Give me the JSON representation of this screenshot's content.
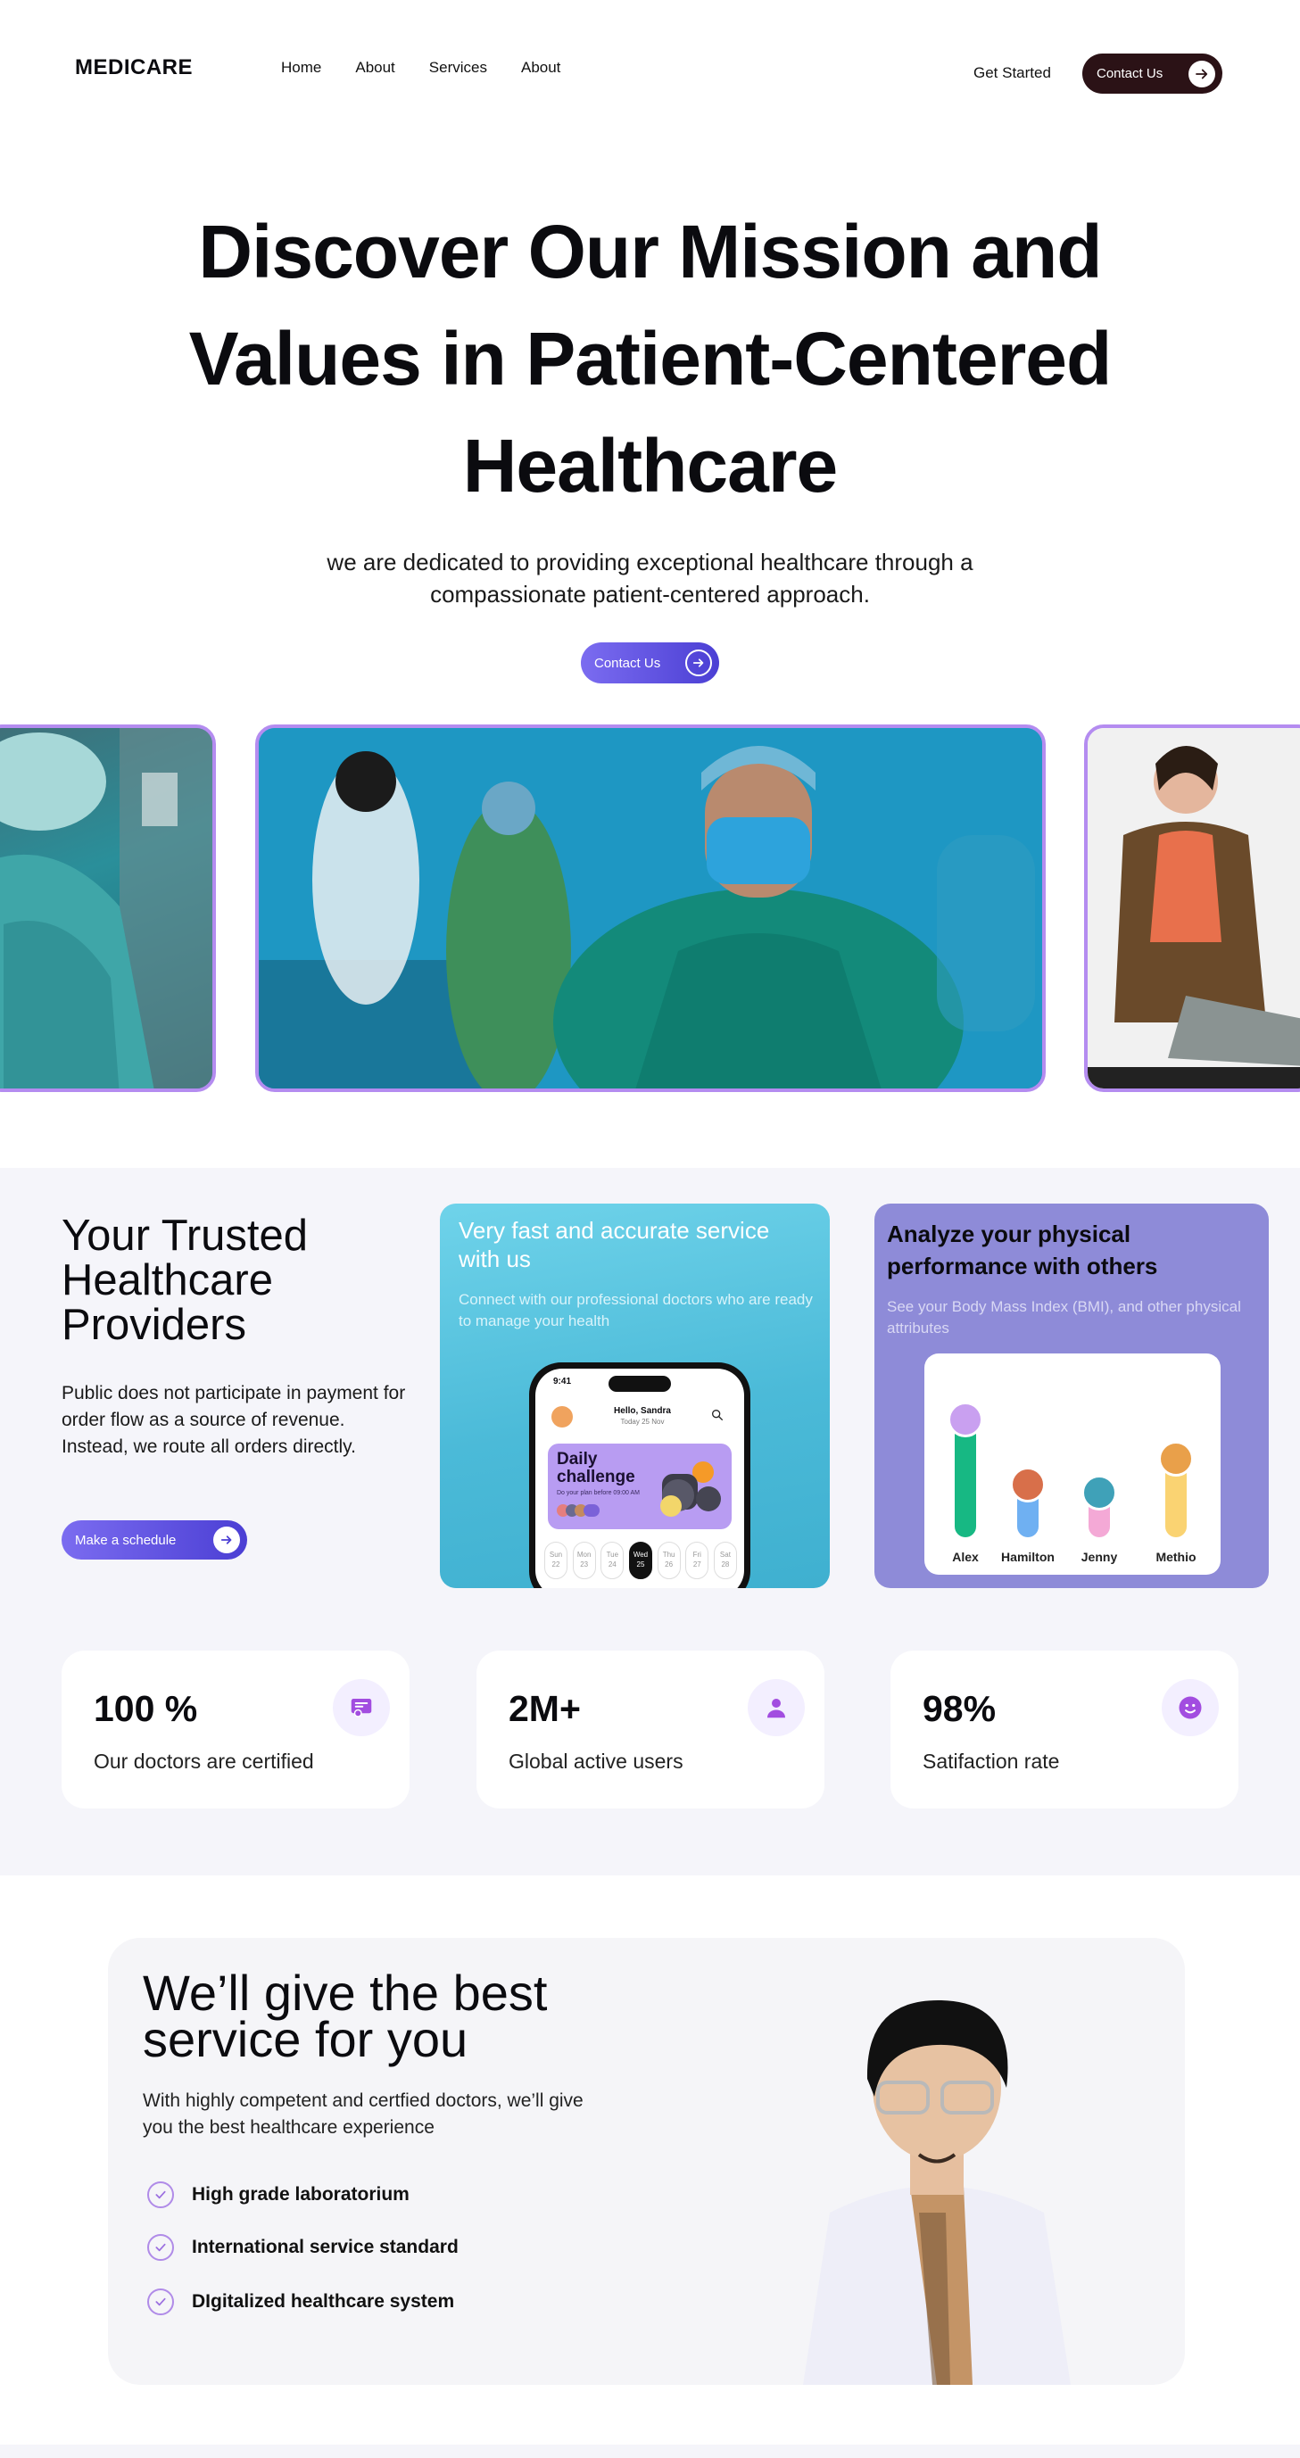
{
  "nav": {
    "logo": "MEDICARE",
    "links": [
      "Home",
      "About",
      "Services",
      "About"
    ],
    "get_started": "Get Started",
    "contact": "Contact Us"
  },
  "hero": {
    "title_lines": [
      "Discover Our Mission and",
      "Values in Patient-Centered",
      "Healthcare"
    ],
    "subtitle": "we are dedicated to providing exceptional healthcare through a compassionate patient-centered approach.",
    "contact": "Contact Us"
  },
  "trusted": {
    "title": "Your Trusted Healthcare Providers",
    "description": "Public does not participate in payment for order flow as a source of revenue. Instead, we route all orders directly.",
    "button": "Make a schedule"
  },
  "service_card": {
    "title": "Very fast and accurate service with us",
    "description": "Connect with our professional doctors who are ready to manage your health",
    "phone": {
      "time": "9:41",
      "hello": "Hello, Sandra",
      "date": "Today 25 Nov",
      "challenge_title": "Daily challenge",
      "challenge_sub": "Do your plan before 09:00 AM",
      "days": [
        {
          "name": "Sun",
          "num": "22"
        },
        {
          "name": "Mon",
          "num": "23"
        },
        {
          "name": "Tue",
          "num": "24"
        },
        {
          "name": "Wed",
          "num": "25"
        },
        {
          "name": "Thu",
          "num": "26"
        },
        {
          "name": "Fri",
          "num": "27"
        },
        {
          "name": "Sat",
          "num": "28"
        }
      ]
    }
  },
  "bmi_card": {
    "title": "Analyze your physical performance with others",
    "description": "See  your Body Mass Index (BMI), and other physical attributes",
    "people": [
      {
        "name": "Alex",
        "level": 1.0,
        "color": "#17b883"
      },
      {
        "name": "Hamilton",
        "level": 0.45,
        "color": "#6fb0f2"
      },
      {
        "name": "Jenny",
        "level": 0.38,
        "color": "#f4a9d6"
      },
      {
        "name": "Methio",
        "level": 0.67,
        "color": "#fad372"
      }
    ]
  },
  "stats": [
    {
      "value": "100 %",
      "label": "Our doctors are certified",
      "icon": "certificate-icon"
    },
    {
      "value": "2M+",
      "label": "Global active users",
      "icon": "user-icon"
    },
    {
      "value": "98%",
      "label": "Satifaction rate",
      "icon": "smile-icon"
    }
  ],
  "best": {
    "title": "We’ll give the best service for you",
    "description": "With highly competent and certfied doctors, we’ll give you the best healthcare experience",
    "features": [
      "High grade laboratorium",
      "International service standard",
      "DIgitalized healthcare system"
    ]
  },
  "colors": {
    "accent": "#6b5cf0",
    "dark_button": "#2b1216",
    "check": "#b08be8"
  }
}
